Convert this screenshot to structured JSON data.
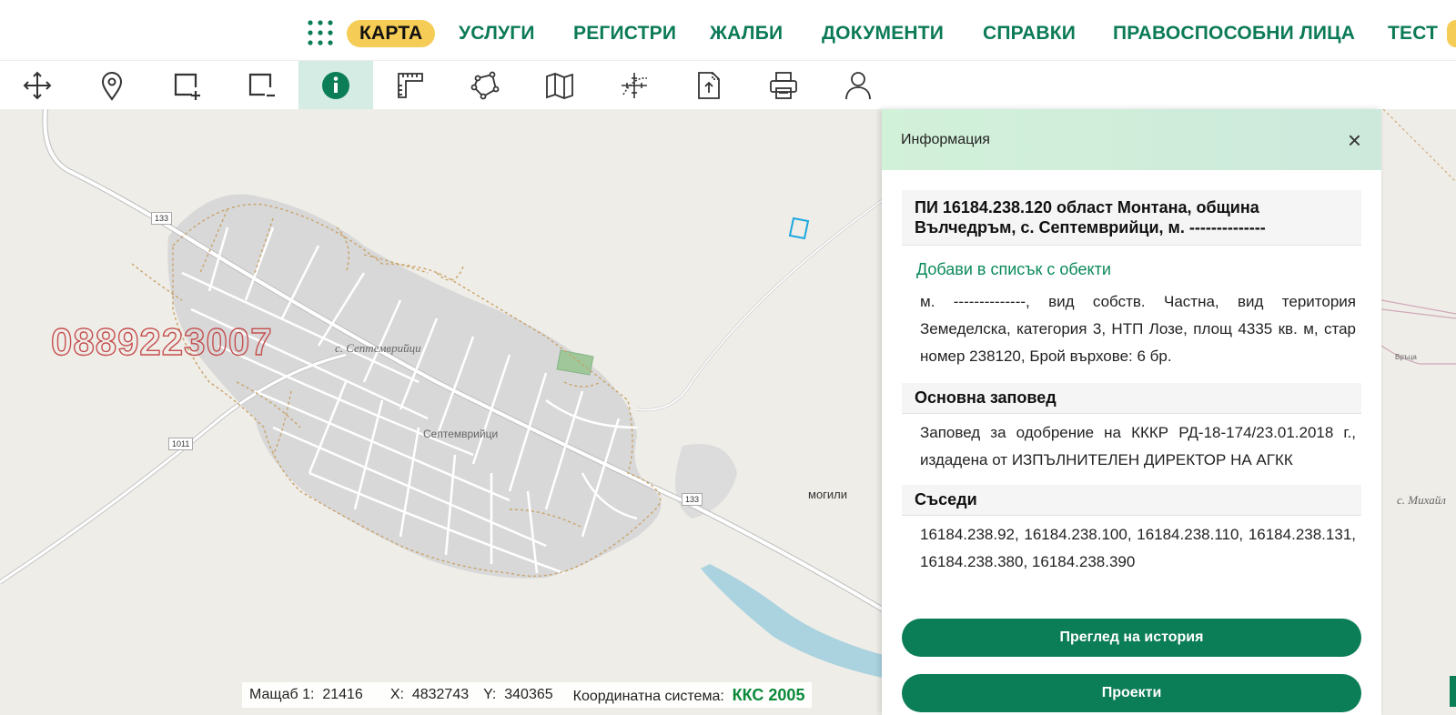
{
  "nav": {
    "items": [
      {
        "label": "КАРТА",
        "active": true
      },
      {
        "label": "УСЛУГИ"
      },
      {
        "label": "РЕГИСТРИ"
      },
      {
        "label": "ЖАЛБИ"
      },
      {
        "label": "ДОКУМЕНТИ"
      },
      {
        "label": "СПРАВКИ"
      },
      {
        "label": "ПРАВОСПОСОБНИ ЛИЦА"
      },
      {
        "label": "ТЕСТ"
      }
    ]
  },
  "toolbar": {
    "tools": [
      {
        "icon": "move-icon"
      },
      {
        "icon": "location-pin-icon"
      },
      {
        "icon": "zoom-in-box-icon"
      },
      {
        "icon": "zoom-out-box-icon"
      },
      {
        "icon": "info-icon",
        "active": true
      },
      {
        "icon": "ruler-icon"
      },
      {
        "icon": "polygon-icon"
      },
      {
        "icon": "map-layers-icon"
      },
      {
        "icon": "coordinates-icon"
      },
      {
        "icon": "upload-file-icon"
      },
      {
        "icon": "print-icon"
      },
      {
        "icon": "user-icon"
      }
    ]
  },
  "map": {
    "watermark": "0889223007",
    "labels": {
      "village_serif": "с. Септември̃йци",
      "village_center": "Септемврийци",
      "mogili": "могили",
      "mihaylovo": "с. Михайл",
      "vrytsa": "Връца"
    },
    "roads": [
      "133",
      "1011",
      "133"
    ]
  },
  "status": {
    "scale_label": "Мащаб 1:",
    "scale_value": "21416",
    "x_label": "X:",
    "x_value": "4832743",
    "y_label": "Y:",
    "y_value": "340365",
    "crs_label": "Координатна система:",
    "crs_value": "ККС 2005"
  },
  "panel": {
    "title": "Информация",
    "parcel_heading": "ПИ 16184.238.120 област Монтана, община Вълчедръм, с. Септемврийци, м. --------------",
    "add_link": "Добави в списък с обекти",
    "description": "м. --------------, вид собств. Частна, вид територия Земеделска, категория 3, НТП Лозе, площ 4335 кв. м, стар номер 238120, Брой върхове: 6 бр.",
    "order_title": "Основна заповед",
    "order_text": "Заповед за одобрение на КККР РД-18-174/23.01.2018 г., издадена от ИЗПЪЛНИТЕЛЕН ДИРЕКТОР НА АГКК",
    "neighbors_title": "Съседи",
    "neighbors_text": "16184.238.92, 16184.238.100, 16184.238.110, 16184.238.131, 16184.238.380, 16184.238.390",
    "history_button": "Преглед на история",
    "projects_button": "Проекти"
  },
  "colors": {
    "brand_green": "#0b7d57",
    "active_nav": "#f5cc55",
    "crs_green": "#0b8a3a"
  }
}
